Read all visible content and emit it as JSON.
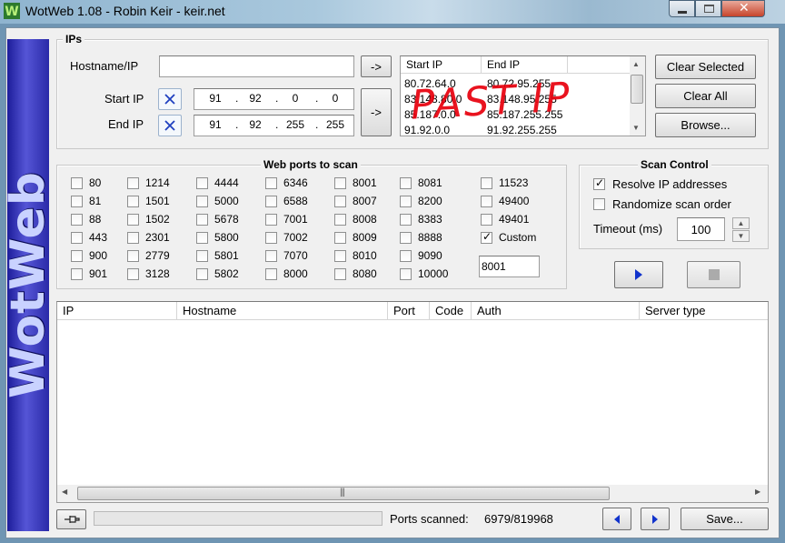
{
  "window": {
    "title": "WotWeb 1.08 - Robin Keir - keir.net",
    "brand": "WotWeb",
    "icon": "wotweb-w-icon"
  },
  "ips": {
    "group_title": "IPs",
    "hostname_label": "Hostname/IP",
    "hostname_value": "",
    "start_label": "Start IP",
    "end_label": "End IP",
    "start_ip": [
      "91",
      "92",
      "0",
      "0"
    ],
    "end_ip": [
      "91",
      "92",
      "255",
      "255"
    ],
    "arrow_label": "->",
    "list_headers": [
      "Start IP",
      "End IP"
    ],
    "list_rows": [
      [
        "80.72.64.0",
        "80.72.95.255"
      ],
      [
        "83.148.80.0",
        "83.148.95.255"
      ],
      [
        "85.187.0.0",
        "85.187.255.255"
      ],
      [
        "91.92.0.0",
        "91.92.255.255"
      ]
    ],
    "annotation": "PAST IP",
    "clear_selected": "Clear Selected",
    "clear_all": "Clear All",
    "browse": "Browse..."
  },
  "ports": {
    "group_title": "Web ports to scan",
    "columns": [
      [
        "80",
        "81",
        "88",
        "443",
        "900",
        "901"
      ],
      [
        "1214",
        "1501",
        "1502",
        "2301",
        "2779",
        "3128"
      ],
      [
        "4444",
        "5000",
        "5678",
        "5800",
        "5801",
        "5802"
      ],
      [
        "6346",
        "6588",
        "7001",
        "7002",
        "7070",
        "8000"
      ],
      [
        "8001",
        "8007",
        "8008",
        "8009",
        "8010",
        "8080"
      ],
      [
        "8081",
        "8200",
        "8383",
        "8888",
        "9090",
        "10000"
      ],
      [
        "11523",
        "49400",
        "49401",
        "Custom"
      ]
    ],
    "custom_checked": true,
    "custom_value": "8001"
  },
  "scan_control": {
    "group_title": "Scan Control",
    "resolve_label": "Resolve IP addresses",
    "resolve_checked": true,
    "randomize_label": "Randomize scan order",
    "randomize_checked": false,
    "timeout_label": "Timeout (ms)",
    "timeout_value": "100"
  },
  "results": {
    "columns": [
      "IP",
      "Hostname",
      "Port",
      "Code",
      "Auth",
      "Server type"
    ],
    "rows": []
  },
  "status": {
    "ports_scanned_label": "Ports scanned:",
    "ports_scanned_value": "6979/819968",
    "progress": 0,
    "save_label": "Save..."
  }
}
